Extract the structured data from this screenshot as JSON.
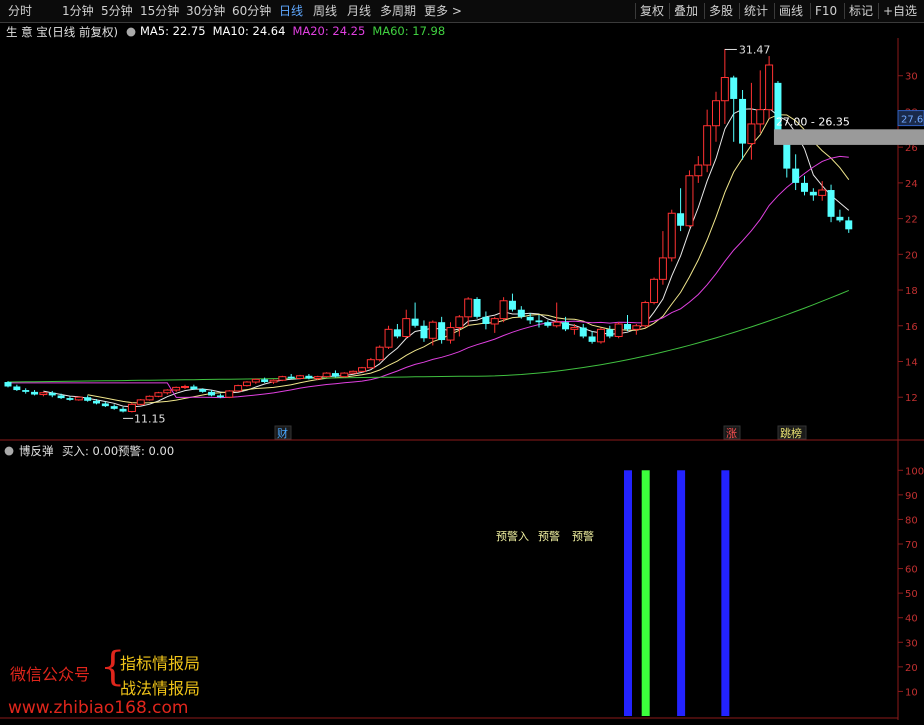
{
  "toolbar": {
    "periods": [
      {
        "label": "分时"
      },
      {
        "label": "1分钟"
      },
      {
        "label": "5分钟"
      },
      {
        "label": "15分钟"
      },
      {
        "label": "30分钟"
      },
      {
        "label": "60分钟"
      },
      {
        "label": "日线",
        "active": true
      },
      {
        "label": "周线"
      },
      {
        "label": "月线"
      },
      {
        "label": "多周期"
      },
      {
        "label": "更多 >"
      }
    ],
    "tools": [
      {
        "label": "复权"
      },
      {
        "label": "叠加"
      },
      {
        "label": "多股"
      },
      {
        "label": "统计"
      },
      {
        "label": "画线"
      },
      {
        "label": "F10"
      },
      {
        "label": "标记"
      },
      {
        "label": "+自选"
      }
    ]
  },
  "main_panel": {
    "title": "生 意 宝(日线 前复权)",
    "ma_items": [
      {
        "text": "MA5: 22.75",
        "color": "#ffffff"
      },
      {
        "text": "MA10: 24.64",
        "color": "#ffffff"
      },
      {
        "text": "MA20: 24.25",
        "color": "#e040e0"
      },
      {
        "text": "MA60: 17.98",
        "color": "#40d040"
      }
    ],
    "price_ticks": [
      "30",
      "28",
      "26",
      "24",
      "22",
      "20",
      "18",
      "16",
      "14",
      "12"
    ],
    "current_price_tag": "27.6",
    "range_label": "27.00 - 26.35",
    "high_label": "31.47",
    "low_label": "11.15",
    "markers": [
      {
        "text": "财",
        "color": "#4aa8ff"
      },
      {
        "text": "涨",
        "color": "#ff5050"
      },
      {
        "text": "跳榜",
        "color": "#e8e070"
      }
    ]
  },
  "sub_panel": {
    "title": "博反弹",
    "buy_label": "买入: 0.00",
    "warn_label": "预警: 0.00",
    "ticks": [
      "100",
      "90",
      "80",
      "70",
      "60",
      "50",
      "40",
      "30",
      "20",
      "10"
    ],
    "signal_labels": [
      "预警入",
      "预警",
      "预警"
    ]
  },
  "chart_data": {
    "type": "candlestick",
    "y_range": [
      10.5,
      32
    ],
    "candles": [
      [
        12.85,
        12.9,
        12.55,
        12.6
      ],
      [
        12.6,
        12.7,
        12.35,
        12.4
      ],
      [
        12.4,
        12.5,
        12.2,
        12.3
      ],
      [
        12.3,
        12.4,
        12.1,
        12.15
      ],
      [
        12.15,
        12.3,
        12.05,
        12.25
      ],
      [
        12.25,
        12.35,
        12.0,
        12.1
      ],
      [
        12.1,
        12.2,
        11.9,
        11.95
      ],
      [
        11.95,
        12.05,
        11.8,
        11.85
      ],
      [
        11.85,
        12.05,
        11.8,
        12.0
      ],
      [
        12.0,
        12.1,
        11.75,
        11.8
      ],
      [
        11.8,
        11.9,
        11.6,
        11.65
      ],
      [
        11.65,
        11.75,
        11.45,
        11.5
      ],
      [
        11.5,
        11.6,
        11.3,
        11.35
      ],
      [
        11.35,
        11.45,
        11.15,
        11.2
      ],
      [
        11.2,
        11.7,
        11.15,
        11.6
      ],
      [
        11.6,
        11.9,
        11.55,
        11.85
      ],
      [
        11.85,
        12.1,
        11.8,
        12.05
      ],
      [
        12.05,
        12.3,
        12.0,
        12.25
      ],
      [
        12.25,
        12.45,
        12.15,
        12.4
      ],
      [
        12.4,
        12.6,
        12.3,
        12.55
      ],
      [
        12.55,
        12.7,
        12.45,
        12.6
      ],
      [
        12.6,
        12.7,
        12.4,
        12.45
      ],
      [
        12.45,
        12.5,
        12.25,
        12.3
      ],
      [
        12.3,
        12.4,
        12.05,
        12.1
      ],
      [
        12.1,
        12.2,
        11.95,
        12.0
      ],
      [
        12.0,
        12.4,
        11.95,
        12.35
      ],
      [
        12.35,
        12.7,
        12.3,
        12.65
      ],
      [
        12.65,
        12.9,
        12.6,
        12.85
      ],
      [
        12.85,
        13.05,
        12.75,
        13.0
      ],
      [
        13.0,
        13.1,
        12.8,
        12.85
      ],
      [
        12.85,
        13.0,
        12.75,
        12.95
      ],
      [
        12.95,
        13.2,
        12.9,
        13.15
      ],
      [
        13.15,
        13.3,
        13.0,
        13.05
      ],
      [
        13.05,
        13.25,
        13.0,
        13.2
      ],
      [
        13.2,
        13.3,
        13.0,
        13.05
      ],
      [
        13.05,
        13.2,
        12.95,
        13.15
      ],
      [
        13.15,
        13.4,
        13.1,
        13.35
      ],
      [
        13.35,
        13.5,
        13.1,
        13.15
      ],
      [
        13.15,
        13.4,
        13.1,
        13.35
      ],
      [
        13.35,
        13.5,
        13.3,
        13.45
      ],
      [
        13.45,
        13.7,
        13.4,
        13.65
      ],
      [
        13.65,
        14.2,
        13.6,
        14.1
      ],
      [
        14.1,
        14.9,
        14.0,
        14.8
      ],
      [
        14.8,
        16.0,
        14.7,
        15.8
      ],
      [
        15.8,
        16.1,
        15.3,
        15.4
      ],
      [
        15.4,
        16.9,
        15.3,
        16.4
      ],
      [
        16.4,
        17.3,
        15.9,
        16.0
      ],
      [
        16.0,
        16.3,
        15.1,
        15.3
      ],
      [
        15.3,
        16.3,
        14.9,
        16.2
      ],
      [
        16.2,
        16.5,
        15.0,
        15.2
      ],
      [
        15.2,
        16.2,
        15.0,
        15.9
      ],
      [
        15.9,
        16.6,
        15.4,
        16.5
      ],
      [
        16.5,
        17.6,
        16.0,
        17.5
      ],
      [
        17.5,
        17.6,
        16.4,
        16.5
      ],
      [
        16.5,
        16.8,
        15.8,
        16.1
      ],
      [
        16.1,
        16.5,
        15.6,
        16.4
      ],
      [
        16.4,
        17.6,
        16.2,
        17.4
      ],
      [
        17.4,
        17.8,
        16.8,
        16.9
      ],
      [
        16.9,
        17.1,
        16.4,
        16.5
      ],
      [
        16.5,
        16.7,
        16.1,
        16.3
      ],
      [
        16.3,
        16.6,
        15.9,
        16.2
      ],
      [
        16.2,
        16.3,
        15.9,
        16.0
      ],
      [
        16.0,
        17.3,
        15.9,
        16.2
      ],
      [
        16.2,
        16.5,
        15.7,
        15.8
      ],
      [
        15.8,
        16.1,
        15.5,
        15.9
      ],
      [
        15.9,
        16.1,
        15.3,
        15.4
      ],
      [
        15.4,
        15.7,
        15.0,
        15.1
      ],
      [
        15.1,
        15.9,
        15.0,
        15.8
      ],
      [
        15.8,
        16.0,
        15.3,
        15.4
      ],
      [
        15.4,
        16.2,
        15.3,
        16.1
      ],
      [
        16.1,
        16.6,
        15.7,
        15.8
      ],
      [
        15.8,
        16.1,
        15.5,
        16.0
      ],
      [
        16.0,
        17.4,
        15.9,
        17.3
      ],
      [
        17.3,
        18.7,
        17.2,
        18.6
      ],
      [
        18.6,
        21.3,
        18.3,
        19.8
      ],
      [
        19.8,
        22.5,
        19.6,
        22.3
      ],
      [
        22.3,
        23.7,
        21.3,
        21.6
      ],
      [
        21.6,
        24.7,
        21.5,
        24.4
      ],
      [
        24.4,
        25.5,
        24.0,
        25.0
      ],
      [
        25.0,
        28.1,
        24.6,
        27.2
      ],
      [
        27.2,
        29.1,
        26.3,
        28.6
      ],
      [
        28.6,
        31.5,
        27.3,
        29.9
      ],
      [
        29.9,
        30.0,
        26.3,
        28.7
      ],
      [
        28.7,
        29.2,
        25.3,
        26.2
      ],
      [
        26.2,
        29.6,
        25.3,
        27.3
      ],
      [
        27.3,
        30.3,
        26.8,
        28.1
      ],
      [
        28.1,
        31.1,
        27.6,
        30.6
      ],
      [
        29.6,
        29.7,
        26.3,
        26.6
      ],
      [
        26.3,
        26.5,
        24.3,
        24.8
      ],
      [
        24.8,
        25.6,
        23.6,
        24.0
      ],
      [
        24.0,
        24.4,
        23.3,
        23.5
      ],
      [
        23.5,
        23.7,
        23.0,
        23.3
      ],
      [
        23.3,
        24.1,
        23.0,
        23.6
      ],
      [
        23.6,
        23.9,
        21.8,
        22.1
      ],
      [
        22.1,
        22.5,
        21.8,
        21.9
      ],
      [
        21.9,
        22.1,
        21.2,
        21.4
      ]
    ],
    "ma5_end": 22.75,
    "ma10_end": 24.64,
    "ma20_end": 24.25,
    "ma60_end": 17.98,
    "sub_y_range": [
      0,
      105
    ],
    "sub_bars": [
      {
        "candle_index": 70,
        "value": 100,
        "color": "#2323ff"
      },
      {
        "candle_index": 72,
        "value": 100,
        "color": "#3cff3c"
      },
      {
        "candle_index": 76,
        "value": 100,
        "color": "#2323ff"
      },
      {
        "candle_index": 81,
        "value": 100,
        "color": "#2323ff"
      }
    ]
  },
  "watermark": {
    "line1": "微信公众号",
    "brace": "{",
    "line2": "指标情报局",
    "line3": "战法情报局",
    "site": "www.zhibiao168.com"
  }
}
